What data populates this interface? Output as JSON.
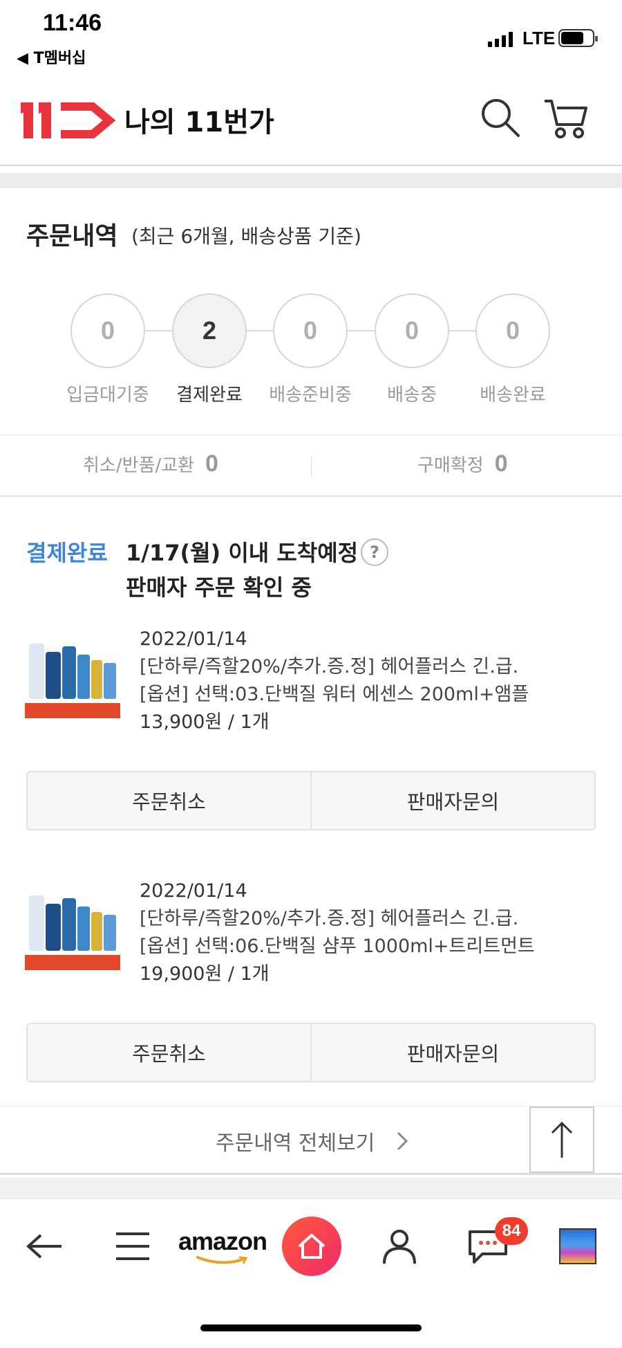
{
  "status_bar": {
    "time": "11:46",
    "back_app": "◀ T멤버십",
    "network": "LTE"
  },
  "header": {
    "logo_text": "11",
    "title": "나의 11번가"
  },
  "orders": {
    "title": "주문내역",
    "subtitle": "(최근 6개월, 배송상품 기준)",
    "steps": [
      {
        "count": "0",
        "label": "입금대기중"
      },
      {
        "count": "2",
        "label": "결제완료"
      },
      {
        "count": "0",
        "label": "배송준비중"
      },
      {
        "count": "0",
        "label": "배송중"
      },
      {
        "count": "0",
        "label": "배송완료"
      }
    ],
    "cancel_return_label": "취소/반품/교환",
    "cancel_return_count": "0",
    "purchase_confirm_label": "구매확정",
    "purchase_confirm_count": "0"
  },
  "status_block": {
    "status": "결제완료",
    "arrival_line1": "1/17(월) 이내 도착예정",
    "arrival_line2": "판매자 주문 확인 중",
    "help": "?"
  },
  "items": [
    {
      "date": "2022/01/14",
      "name": "[단하루/즉할20%/추가.증.정] 헤어플러스 긴.급.",
      "option": "[옵션] 선택:03.단백질 워터 에센스 200ml+앰플",
      "price": "13,900원 / 1개",
      "cancel_label": "주문취소",
      "inquiry_label": "판매자문의"
    },
    {
      "date": "2022/01/14",
      "name": "[단하루/즉할20%/추가.증.정] 헤어플러스 긴.급.",
      "option": "[옵션] 선택:06.단백질 샴푸 1000ml+트리트먼트",
      "price": "19,900원 / 1개",
      "cancel_label": "주문취소",
      "inquiry_label": "판매자문의"
    }
  ],
  "view_all": "주문내역 전체보기",
  "bottom_nav": {
    "amazon": "amazon",
    "chat_badge": "84"
  },
  "colors": {
    "brand_red": "#e8323c",
    "status_blue": "#3d86d6",
    "badge_red": "#f03b2e"
  }
}
